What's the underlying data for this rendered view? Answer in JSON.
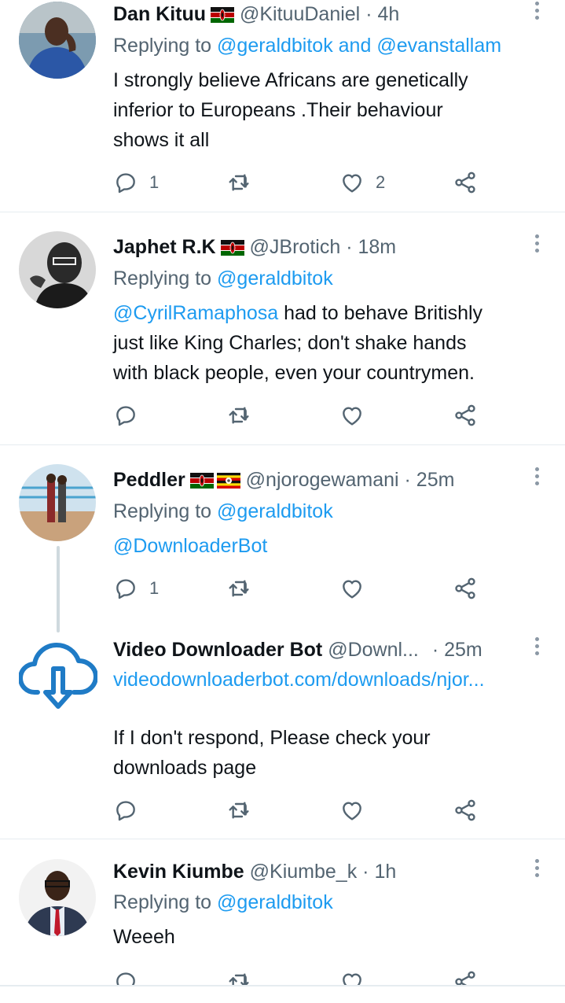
{
  "tweets": [
    {
      "name": "Dan Kituu",
      "handle": "@KituuDaniel",
      "time": "· 4h",
      "replying_prefix": "Replying to",
      "replying_to": "@geraldbitok and @evanstallam",
      "body_lines": [
        "I strongly believe Africans are genetically",
        "inferior to Europeans .Their behaviour",
        "shows it all"
      ],
      "reply_count": "1",
      "like_count": "2"
    },
    {
      "name": "Japhet R.K",
      "handle": "@JBrotich",
      "time": "· 18m",
      "replying_prefix": "Replying to",
      "replying_to": "@geraldbitok",
      "mention": "@CyrilRamaphosa",
      "body_line1_rest": " had to behave Britishly",
      "body_lines": [
        "just like King Charles; don't shake hands",
        "with black people, even your countrymen."
      ]
    },
    {
      "name": "Peddler",
      "handle": "@njorogewamani",
      "time": "· 25m",
      "replying_prefix": "Replying to",
      "replying_to": "@geraldbitok",
      "mention": "@DownloaderBot",
      "reply_count": "1"
    },
    {
      "name": "Video Downloader Bot",
      "handle": "@Downl...",
      "time": "· 25m",
      "link": "videodownloaderbot.com/downloads/njor...",
      "body_lines": [
        "If I don't respond, Please check your",
        "downloads page"
      ]
    },
    {
      "name": "Kevin Kiumbe",
      "handle": "@Kiumbe_k",
      "time": "· 1h",
      "replying_prefix": "Replying to",
      "replying_to": "@geraldbitok",
      "body": "Weeeh"
    }
  ],
  "icons": {
    "reply": "reply-icon",
    "retweet": "retweet-icon",
    "like": "like-icon",
    "share": "share-icon",
    "more": "more-icon"
  },
  "colors": {
    "link": "#1d9bf0",
    "secondary": "#536471",
    "text": "#0f1419",
    "kenya_red": "#bb0000",
    "kenya_green": "#006600",
    "uganda_yellow": "#fcdc04",
    "cloud_blue": "#1f7bc6"
  }
}
